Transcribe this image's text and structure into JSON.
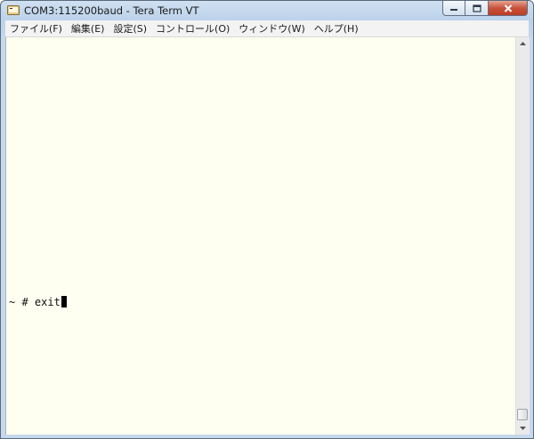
{
  "window": {
    "title": "COM3:115200baud - Tera Term VT",
    "controls": {
      "minimize_icon": "minimize-icon",
      "maximize_icon": "maximize-icon",
      "close_icon": "close-icon"
    }
  },
  "menubar": {
    "items": [
      {
        "label": "ファイル(F)"
      },
      {
        "label": "編集(E)"
      },
      {
        "label": "設定(S)"
      },
      {
        "label": "コントロール(O)"
      },
      {
        "label": "ウィンドウ(W)"
      },
      {
        "label": "ヘルプ(H)"
      }
    ]
  },
  "terminal": {
    "line": "~ # exit",
    "background": "#fefff0",
    "text_color": "#111111"
  },
  "colors": {
    "titlebar": "#bcd2ea",
    "close_button": "#c9533a"
  }
}
